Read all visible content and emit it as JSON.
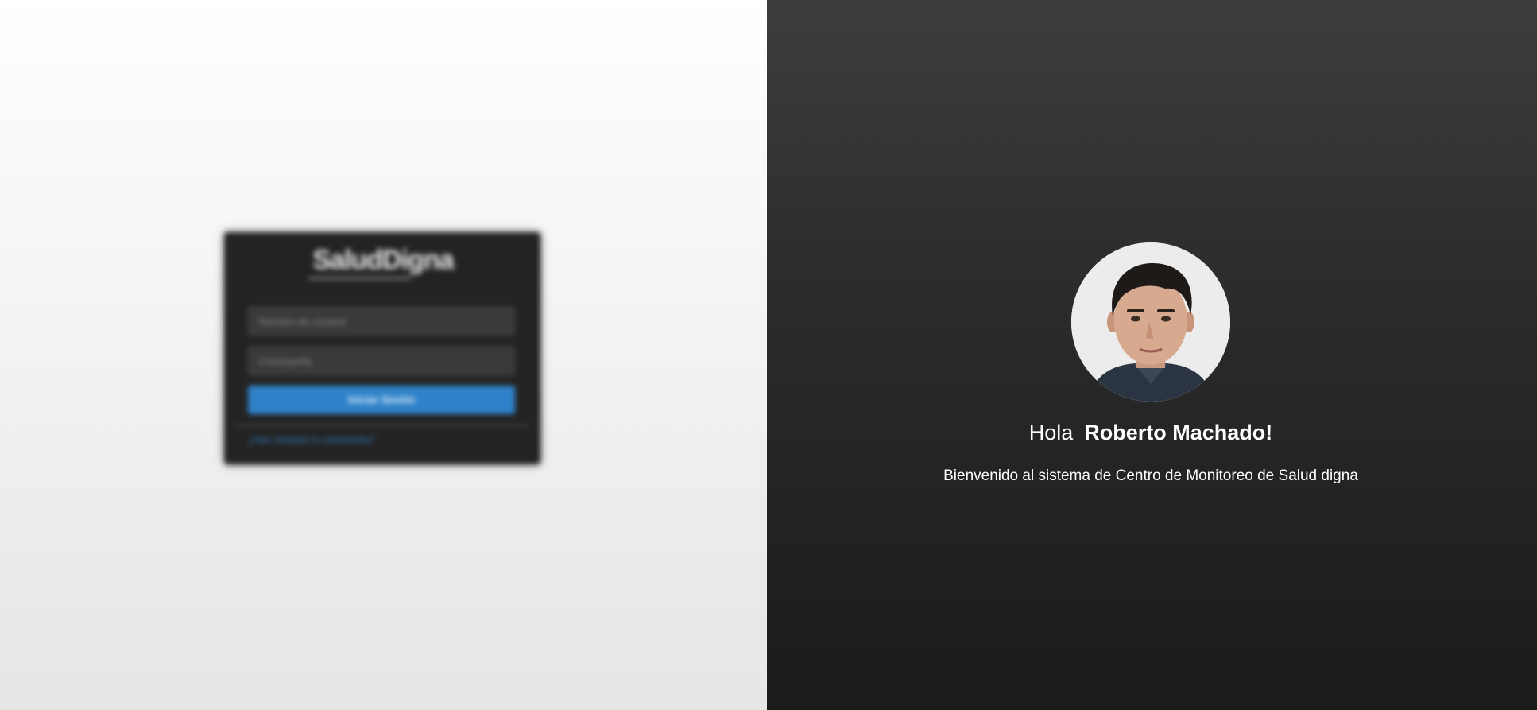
{
  "login": {
    "brand": "SaludDigna",
    "username_placeholder": "Nombre de usuario",
    "password_placeholder": "Contraseña",
    "submit_label": "Iniciar Sesión",
    "link_text": "¿Has olvidado tu contraseña?"
  },
  "welcome": {
    "greeting": "Hola",
    "user_name": "Roberto Machado!",
    "message": "Bienvenido al sistema de Centro de Monitoreo de Salud digna"
  },
  "colors": {
    "accent_blue": "#2f82c9",
    "dark_panel": "#232323",
    "right_top": "#3d3d3d",
    "right_bottom": "#1b1b1b"
  },
  "icons": {
    "avatar": "user-photo"
  }
}
